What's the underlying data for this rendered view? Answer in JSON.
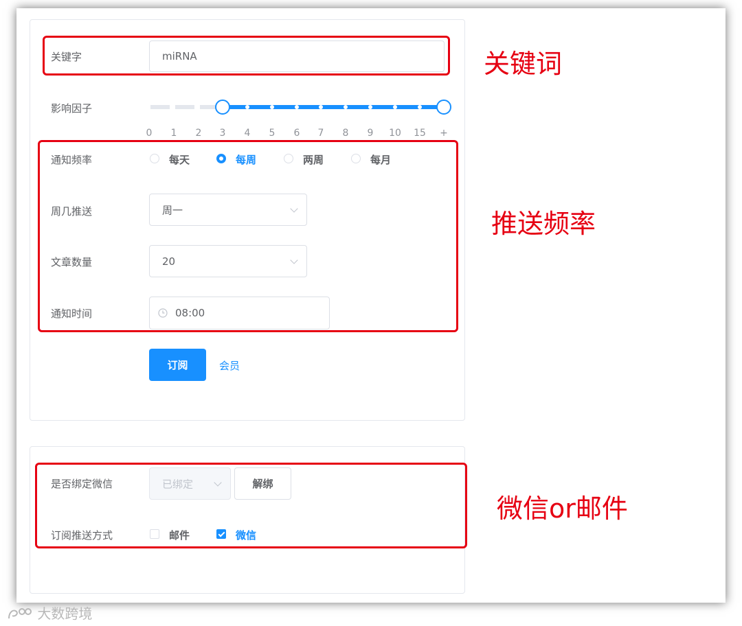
{
  "form": {
    "keyword_label": "关键字",
    "keyword_value": "miRNA",
    "factor_label": "影响因子",
    "factor_ticks": [
      "0",
      "1",
      "2",
      "3",
      "4",
      "5",
      "6",
      "7",
      "8",
      "9",
      "10",
      "15",
      "+"
    ],
    "factor_range": [
      "3",
      "+"
    ],
    "freq_label": "通知频率",
    "freq_options": [
      "每天",
      "每周",
      "两周",
      "每月"
    ],
    "freq_selected": "每周",
    "weekday_label": "周几推送",
    "weekday_value": "周一",
    "count_label": "文章数量",
    "count_value": "20",
    "time_label": "通知时间",
    "time_value": "08:00",
    "subscribe_button": "订阅",
    "member_link": "会员"
  },
  "binding": {
    "wechat_label": "是否绑定微信",
    "wechat_status": "已绑定",
    "unbind_button": "解绑",
    "method_label": "订阅推送方式",
    "method_options": [
      {
        "label": "邮件",
        "checked": false
      },
      {
        "label": "微信",
        "checked": true
      }
    ]
  },
  "annotations": {
    "keyword_note": "关键词",
    "frequency_note": "推送频率",
    "channel_note": "微信or邮件"
  },
  "watermark": "大数跨境",
  "colors": {
    "primary": "#1890ff",
    "annotation": "#e60012"
  },
  "icons": [
    "clock-icon",
    "chevron-down-icon",
    "watermark-logo-icon"
  ]
}
